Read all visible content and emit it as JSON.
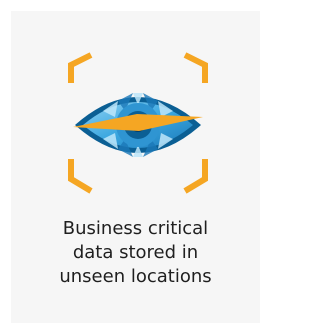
{
  "card": {
    "icon": "eye-scan-icon",
    "caption_lines": [
      "Business critical",
      "data stored in",
      "unseen locations"
    ]
  },
  "colors": {
    "card_background": "#f6f6f6",
    "accent_orange": "#f5a623",
    "eye_blue": "#3aa7e0",
    "eye_dark_blue": "#0b5f94",
    "text": "#1f1f1f"
  }
}
